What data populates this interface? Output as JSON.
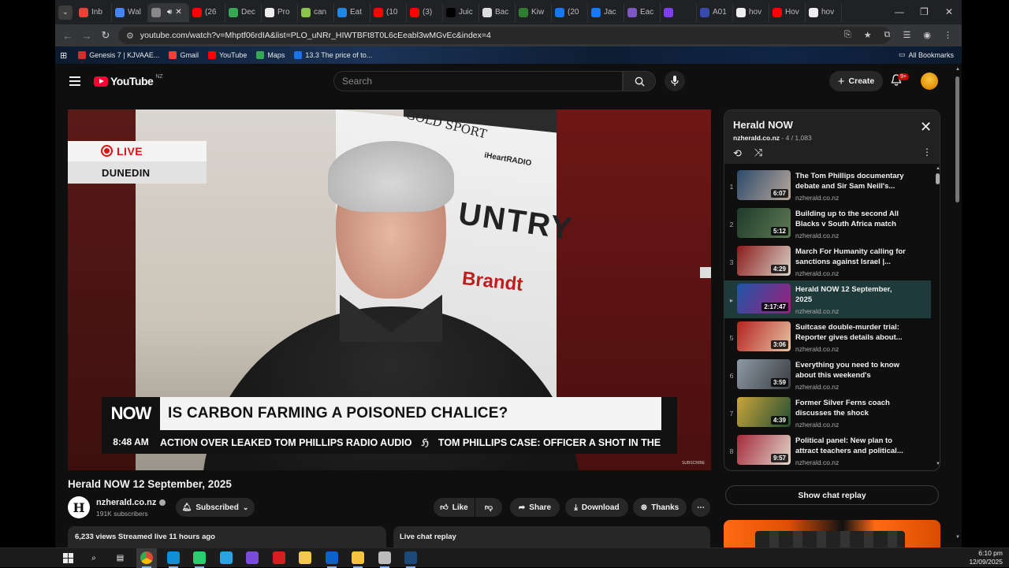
{
  "browser": {
    "tabs": [
      {
        "label": "Inb",
        "color": "#ea4335"
      },
      {
        "label": "Wal",
        "color": "#4285f4"
      },
      {
        "label": "",
        "color": "#888888",
        "active": true
      },
      {
        "label": "(26",
        "color": "#ff0000"
      },
      {
        "label": "Dec",
        "color": "#34a853"
      },
      {
        "label": "Pro",
        "color": "#eeeeee"
      },
      {
        "label": "can",
        "color": "#8bc34a"
      },
      {
        "label": "Eat",
        "color": "#1e88e5"
      },
      {
        "label": "(10",
        "color": "#ff0000"
      },
      {
        "label": "(3)",
        "color": "#ff0000"
      },
      {
        "label": "Juic",
        "color": "#000000"
      },
      {
        "label": "Bac",
        "color": "#dddddd"
      },
      {
        "label": "Kiw",
        "color": "#2e7d32"
      },
      {
        "label": "(20",
        "color": "#1877f2"
      },
      {
        "label": "Jac",
        "color": "#1877f2"
      },
      {
        "label": "Eac",
        "color": "#7e57c2"
      },
      {
        "label": "",
        "color": "#7e3ff2"
      },
      {
        "label": "A01",
        "color": "#3949ab"
      },
      {
        "label": "hov",
        "color": "#eeeeee"
      },
      {
        "label": "Hov",
        "color": "#ff0000"
      },
      {
        "label": "hov",
        "color": "#eeeeee"
      }
    ],
    "url": "youtube.com/watch?v=Mhptf06rdIA&list=PLO_uNRr_HIWTBFt8T0L6cEeabl3wMGvEc&index=4",
    "bookmarks": [
      {
        "label": "Genesis 7 | KJVAAE...",
        "color": "#d32f2f"
      },
      {
        "label": "Gmail",
        "color": "#ea4335"
      },
      {
        "label": "YouTube",
        "color": "#ff0000"
      },
      {
        "label": "Maps",
        "color": "#34a853"
      },
      {
        "label": "13.3 The price of to...",
        "color": "#1a73e8"
      }
    ],
    "all_bookmarks": "All Bookmarks"
  },
  "youtube": {
    "logo_text": "YouTube",
    "country_code": "NZ",
    "search_placeholder": "Search",
    "create_label": "Create",
    "notif_count": "9+"
  },
  "video": {
    "live_label": "LIVE",
    "location": "DUNEDIN",
    "now_label": "NOW",
    "headline": "IS CARBON FARMING A POISONED CHALICE?",
    "time": "8:48 AM",
    "ticker_1": "ACTION OVER LEAKED TOM PHILLIPS RADIO AUDIO",
    "ticker_sep": "ℌ",
    "ticker_2": "TOM PHILLIPS CASE: OFFICER A SHOT IN THE",
    "banner_text_1": "GOLD SPORT",
    "banner_text_2": "iHeartRADIO",
    "banner_text_3": "UNTRY",
    "banner_text_4": "Brandt",
    "subscribe_tag": "SUBSCRIBE",
    "title": "Herald NOW 12 September, 2025",
    "channel": "nzherald.co.nz",
    "channel_logo": "H",
    "subscribers": "191K subscribers",
    "subscribed_label": "Subscribed",
    "like_label": "Like",
    "share_label": "Share",
    "download_label": "Download",
    "thanks_label": "Thanks",
    "views_line": "6,233 views  Streamed live 11 hours ago",
    "live_chat_label": "Live chat replay"
  },
  "playlist": {
    "title": "Herald NOW",
    "channel": "nzherald.co.nz",
    "position": " - 4 / 1,083",
    "items": [
      {
        "index": "1",
        "title": "The Tom Phillips documentary debate and Sir Sam Neill's...",
        "channel": "nzherald.co.nz",
        "duration": "6:07",
        "c1": "#2c4a6b",
        "c2": "#b7a79a"
      },
      {
        "index": "2",
        "title": "Building up to the second All Blacks v South Africa match |...",
        "channel": "nzherald.co.nz",
        "duration": "5:12",
        "c1": "#1d3b2a",
        "c2": "#5f7a55"
      },
      {
        "index": "3",
        "title": "March For Humanity calling for sanctions against Israel |...",
        "channel": "nzherald.co.nz",
        "duration": "4:29",
        "c1": "#8a1c1c",
        "c2": "#d9d2c7"
      },
      {
        "index": "▸",
        "title": "Herald NOW 12 September, 2025",
        "channel": "nzherald.co.nz",
        "duration": "2:17:47",
        "c1": "#1f56a8",
        "c2": "#9d1f7a",
        "current": true
      },
      {
        "index": "5",
        "title": "Suitcase double-murder trial: Reporter gives details about...",
        "channel": "nzherald.co.nz",
        "duration": "3:06",
        "c1": "#b4231f",
        "c2": "#e6c4a5"
      },
      {
        "index": "6",
        "title": "Everything you need to know about this weekend's weather...",
        "channel": "nzherald.co.nz",
        "duration": "3:59",
        "c1": "#8d9aa6",
        "c2": "#3a3d40"
      },
      {
        "index": "7",
        "title": "Former Silver Ferns coach discusses the shock decision...",
        "channel": "nzherald.co.nz",
        "duration": "4:39",
        "c1": "#c9a53a",
        "c2": "#234d33"
      },
      {
        "index": "8",
        "title": "Political panel: New plan to attract teachers and political...",
        "channel": "nzherald.co.nz",
        "duration": "9:57",
        "c1": "#a52a3a",
        "c2": "#e0d7cc"
      }
    ]
  },
  "chat_button": "Show chat replay",
  "taskbar": {
    "time": "6:10 pm",
    "date": "12/09/2025",
    "apps": [
      {
        "name": "search-icon",
        "glyph": "⌕",
        "color": "#1c1c1c"
      },
      {
        "name": "task-view-icon",
        "glyph": "▤",
        "color": "#1c1c1c"
      },
      {
        "name": "chrome-icon",
        "glyph": "",
        "color": "#fbbc05"
      },
      {
        "name": "edge-icon",
        "glyph": "",
        "color": "#0f8fd6"
      },
      {
        "name": "app-green-icon",
        "glyph": "",
        "color": "#2ecc71"
      },
      {
        "name": "telegram-icon",
        "glyph": "",
        "color": "#2aa3e0"
      },
      {
        "name": "app-purple-icon",
        "glyph": "",
        "color": "#7a4ad8"
      },
      {
        "name": "app-red-icon",
        "glyph": "",
        "color": "#d42020"
      },
      {
        "name": "store-icon",
        "glyph": "",
        "color": "#f2c94c"
      },
      {
        "name": "outlook-icon",
        "glyph": "",
        "color": "#0a64c8"
      },
      {
        "name": "file-explorer-icon",
        "glyph": "",
        "color": "#f5c242"
      },
      {
        "name": "app-feather-icon",
        "glyph": "",
        "color": "#bbbbbb"
      },
      {
        "name": "steam-icon",
        "glyph": "",
        "color": "#1b4a7a"
      }
    ]
  }
}
